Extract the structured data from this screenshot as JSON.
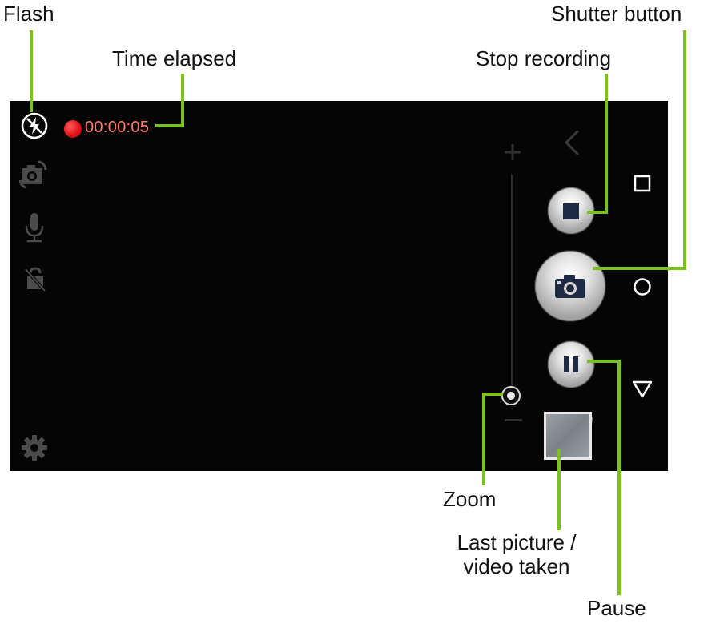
{
  "callouts": {
    "flash": "Flash",
    "time_elapsed": "Time elapsed",
    "stop_recording": "Stop recording",
    "shutter_button": "Shutter button",
    "zoom": "Zoom",
    "last_picture_1": "Last picture /",
    "last_picture_2": "video taken",
    "pause": "Pause"
  },
  "screen": {
    "timer": "00:00:05",
    "left_icons": [
      "flash-off-icon",
      "switch-camera-icon",
      "microphone-icon",
      "lock-off-icon",
      "settings-icon"
    ],
    "right_controls": [
      "back-icon",
      "stop-recording-button",
      "shutter-button",
      "pause-button",
      "last-media-thumbnail"
    ],
    "nav_icons": [
      "recent-apps-icon",
      "home-icon",
      "back-triangle-icon"
    ]
  },
  "colors": {
    "callout_line": "#7cc21c",
    "timer_text": "#ff7b6b",
    "record_dot": "#e3141b"
  }
}
